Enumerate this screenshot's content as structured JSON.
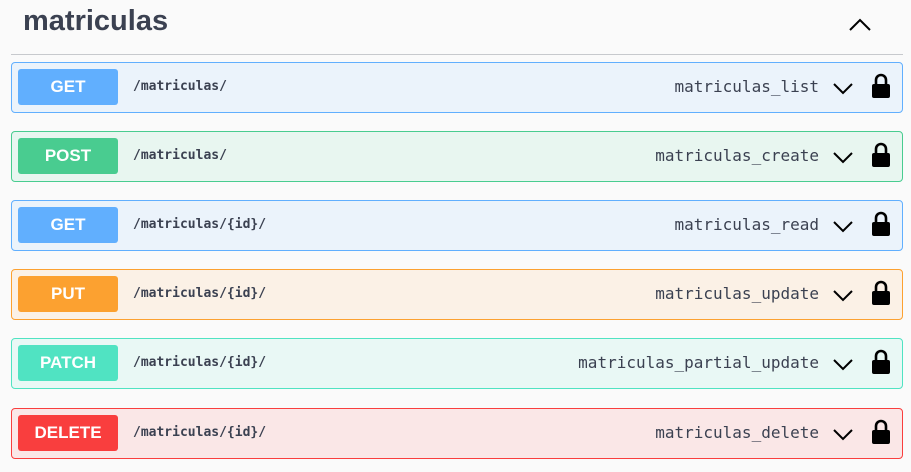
{
  "section": {
    "title": "matriculas",
    "toggle_icon": "chevron-up-icon"
  },
  "operations": [
    {
      "method": "GET",
      "path": "/matriculas/",
      "operation_id": "matriculas_list",
      "color": "#61affe"
    },
    {
      "method": "POST",
      "path": "/matriculas/",
      "operation_id": "matriculas_create",
      "color": "#49cc90"
    },
    {
      "method": "GET",
      "path": "/matriculas/{id}/",
      "operation_id": "matriculas_read",
      "color": "#61affe"
    },
    {
      "method": "PUT",
      "path": "/matriculas/{id}/",
      "operation_id": "matriculas_update",
      "color": "#fca130"
    },
    {
      "method": "PATCH",
      "path": "/matriculas/{id}/",
      "operation_id": "matriculas_partial_update",
      "color": "#50e3c2"
    },
    {
      "method": "DELETE",
      "path": "/matriculas/{id}/",
      "operation_id": "matriculas_delete",
      "color": "#f93e3e"
    }
  ]
}
